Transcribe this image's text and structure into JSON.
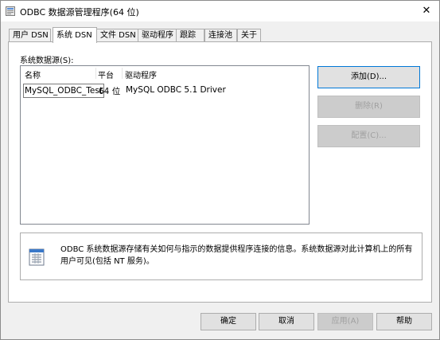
{
  "window": {
    "title": "ODBC 数据源管理程序(64 位)",
    "close_glyph": "✕"
  },
  "tabs": [
    {
      "label": "用户 DSN",
      "active": false
    },
    {
      "label": "系统 DSN",
      "active": true
    },
    {
      "label": "文件 DSN",
      "active": false
    },
    {
      "label": "驱动程序",
      "active": false
    },
    {
      "label": "跟踪",
      "active": false
    },
    {
      "label": "连接池",
      "active": false
    },
    {
      "label": "关于",
      "active": false
    }
  ],
  "system_dsn": {
    "section_label": "系统数据源(S):",
    "columns": [
      "名称",
      "平台",
      "驱动程序"
    ],
    "rows": [
      {
        "name": "MySQL_ODBC_Test",
        "platform": "64 位",
        "driver": "MySQL ODBC 5.1 Driver"
      }
    ],
    "buttons": {
      "add": "添加(D)...",
      "remove": "删除(R)",
      "configure": "配置(C)..."
    },
    "info_text": "ODBC 系统数据源存储有关如何与指示的数据提供程序连接的信息。系统数据源对此计算机上的所有用户可见(包括 NT 服务)。"
  },
  "footer": {
    "ok": "确定",
    "cancel": "取消",
    "apply": "应用(A)",
    "help": "帮助"
  },
  "icons": {
    "app": "odbc-app-icon",
    "info": "database-info-icon"
  },
  "colors": {
    "accent": "#0078d7",
    "window_bg": "#f0f0f0",
    "panel_bg": "#ffffff",
    "disabled_text": "#a0a0a0"
  }
}
